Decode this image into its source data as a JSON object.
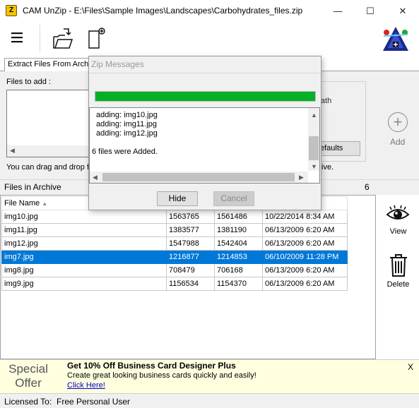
{
  "window": {
    "app_icon_glyph": "Z",
    "title": "CAM UnZip - E:\\Files\\Sample Images\\Landscapes\\Carbohydrates_files.zip",
    "minimize_glyph": "—",
    "maximize_glyph": "☐",
    "close_glyph": "✕"
  },
  "toolbar": {
    "menu_icon": "hamburger-menu-icon",
    "open_icon": "open-folder-icon",
    "new_icon": "new-document-icon",
    "logo_icon": "cam-logo-icon"
  },
  "tabs": {
    "extract_label": "Extract Files From Archive"
  },
  "add_panel": {
    "files_to_add_label": "Files to add :",
    "drag_hint": "You can drag and drop fi",
    "path_label": "ath",
    "defaults_label": "efaults",
    "archive_hint": "ive.",
    "add_label": "Add"
  },
  "archive": {
    "files_in_archive_label": "Files in Archive",
    "file_count": "6",
    "columns": [
      "File Name",
      "",
      "",
      ""
    ],
    "sort_indicator": "▲",
    "rows": [
      {
        "name": "img10.jpg",
        "size": "1563765",
        "packed": "1561486",
        "date": "10/22/2014 8:34 AM"
      },
      {
        "name": "img11.jpg",
        "size": "1383577",
        "packed": "1381190",
        "date": "06/13/2009 6:20 AM"
      },
      {
        "name": "img12.jpg",
        "size": "1547988",
        "packed": "1542404",
        "date": "06/13/2009 6:20 AM"
      },
      {
        "name": "img7.jpg",
        "size": "1216877",
        "packed": "1214853",
        "date": "06/10/2009 11:28 PM"
      },
      {
        "name": "img8.jpg",
        "size": "708479",
        "packed": "706168",
        "date": "06/13/2009 6:20 AM"
      },
      {
        "name": "img9.jpg",
        "size": "1156534",
        "packed": "1154370",
        "date": "06/13/2009 6:20 AM"
      }
    ],
    "selected_row": 3
  },
  "side_actions": {
    "view_label": "View",
    "delete_label": "Delete"
  },
  "promo": {
    "special_line1": "Special",
    "special_line2": "Offer",
    "headline": "Get 10% Off Business Card Designer Plus",
    "description": "Create great looking business cards quickly and easily!",
    "link": "Click Here!",
    "close_glyph": "X"
  },
  "status": {
    "licensed_label": "Licensed To:",
    "licensed_value": "Free Personal User"
  },
  "dialog": {
    "title": "Zip Messages",
    "progress": 1.0,
    "log_lines": [
      "adding: img10.jpg",
      "adding: img11.jpg",
      "adding: img12.jpg",
      "",
      "6 files were Added."
    ],
    "hide_label": "Hide",
    "cancel_label": "Cancel"
  },
  "colors": {
    "selection": "#0078d7",
    "progress": "#06b025",
    "promo_bg": "#ffffe0",
    "link": "#0000cc"
  }
}
